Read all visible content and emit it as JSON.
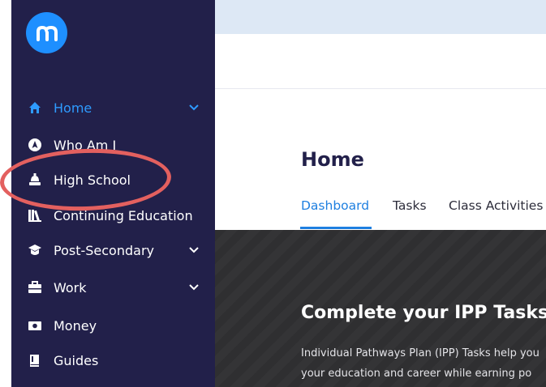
{
  "sidebar": {
    "logo_text": "m",
    "items": [
      {
        "label": "Home",
        "icon": "home-icon",
        "active": true,
        "expandable": true
      },
      {
        "label": "Who Am I",
        "icon": "compass-icon",
        "active": false,
        "expandable": false
      },
      {
        "label": "High School",
        "icon": "school-bell-icon",
        "active": false,
        "expandable": false
      },
      {
        "label": "Continuing Education",
        "icon": "books-icon",
        "active": false,
        "expandable": false
      },
      {
        "label": "Post-Secondary",
        "icon": "graduation-cap-icon",
        "active": false,
        "expandable": true
      },
      {
        "label": "Work",
        "icon": "briefcase-icon",
        "active": false,
        "expandable": true
      },
      {
        "label": "Money",
        "icon": "money-icon",
        "active": false,
        "expandable": false
      },
      {
        "label": "Guides",
        "icon": "guide-book-icon",
        "active": false,
        "expandable": false
      }
    ]
  },
  "main": {
    "page_title": "Home",
    "tabs": [
      {
        "label": "Dashboard",
        "active": true
      },
      {
        "label": "Tasks",
        "active": false
      },
      {
        "label": "Class Activities",
        "active": false
      }
    ],
    "banner": {
      "title": "Complete your IPP Tasks",
      "line1": "Individual Pathways Plan (IPP) Tasks help you",
      "line2": "your education and career while earning po"
    }
  },
  "colors": {
    "sidebar_bg": "#22204a",
    "accent": "#1e8fff",
    "active_tab": "#1e7fe0",
    "highlight_ring": "#e3605f",
    "top_band": "#dde8f5"
  }
}
